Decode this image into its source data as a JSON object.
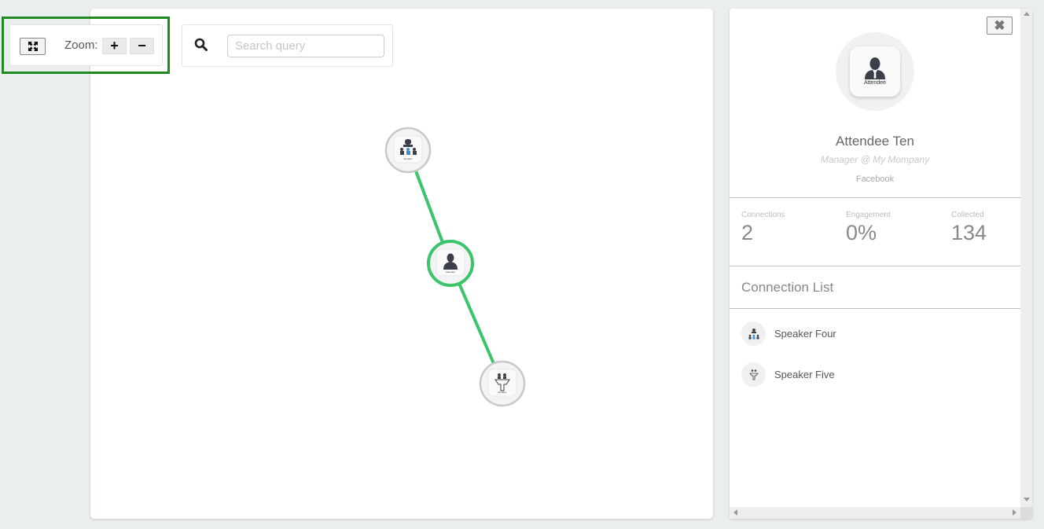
{
  "toolbar": {
    "fit_icon": "expand-arrows-icon",
    "zoom_label": "Zoom:",
    "zoom_in_label": "+",
    "zoom_out_label": "−"
  },
  "search": {
    "icon": "search-icon",
    "placeholder": "Search query",
    "value": ""
  },
  "graph": {
    "edge_color": "#3cc46b",
    "nodes": [
      {
        "id": "speaker-four",
        "label": "Speaker",
        "icon": "speaker-group-icon",
        "selected": false
      },
      {
        "id": "attendee-ten",
        "label": "Attendee",
        "icon": "attendee-icon",
        "selected": true
      },
      {
        "id": "speaker-five",
        "label": "Speaker",
        "icon": "speaker-podium-icon",
        "selected": false
      }
    ],
    "edges": [
      {
        "from": "speaker-four",
        "to": "attendee-ten"
      },
      {
        "from": "attendee-ten",
        "to": "speaker-five"
      }
    ]
  },
  "detail": {
    "close_label": "✖",
    "avatar_caption": "Attendee",
    "name": "Attendee Ten",
    "role": "Manager @ My Mompany",
    "source": "Facebook",
    "stats": [
      {
        "label": "Connections",
        "value": "2"
      },
      {
        "label": "Engagement",
        "value": "0%"
      },
      {
        "label": "Collected",
        "value": "134"
      }
    ],
    "connection_list_title": "Connection List",
    "connections": [
      {
        "name": "Speaker Four",
        "icon": "speaker-group-icon"
      },
      {
        "name": "Speaker Five",
        "icon": "speaker-podium-icon"
      }
    ]
  },
  "colors": {
    "highlight_border": "#1f8a1f",
    "edge": "#3cc46b",
    "background": "#ebeeee"
  }
}
